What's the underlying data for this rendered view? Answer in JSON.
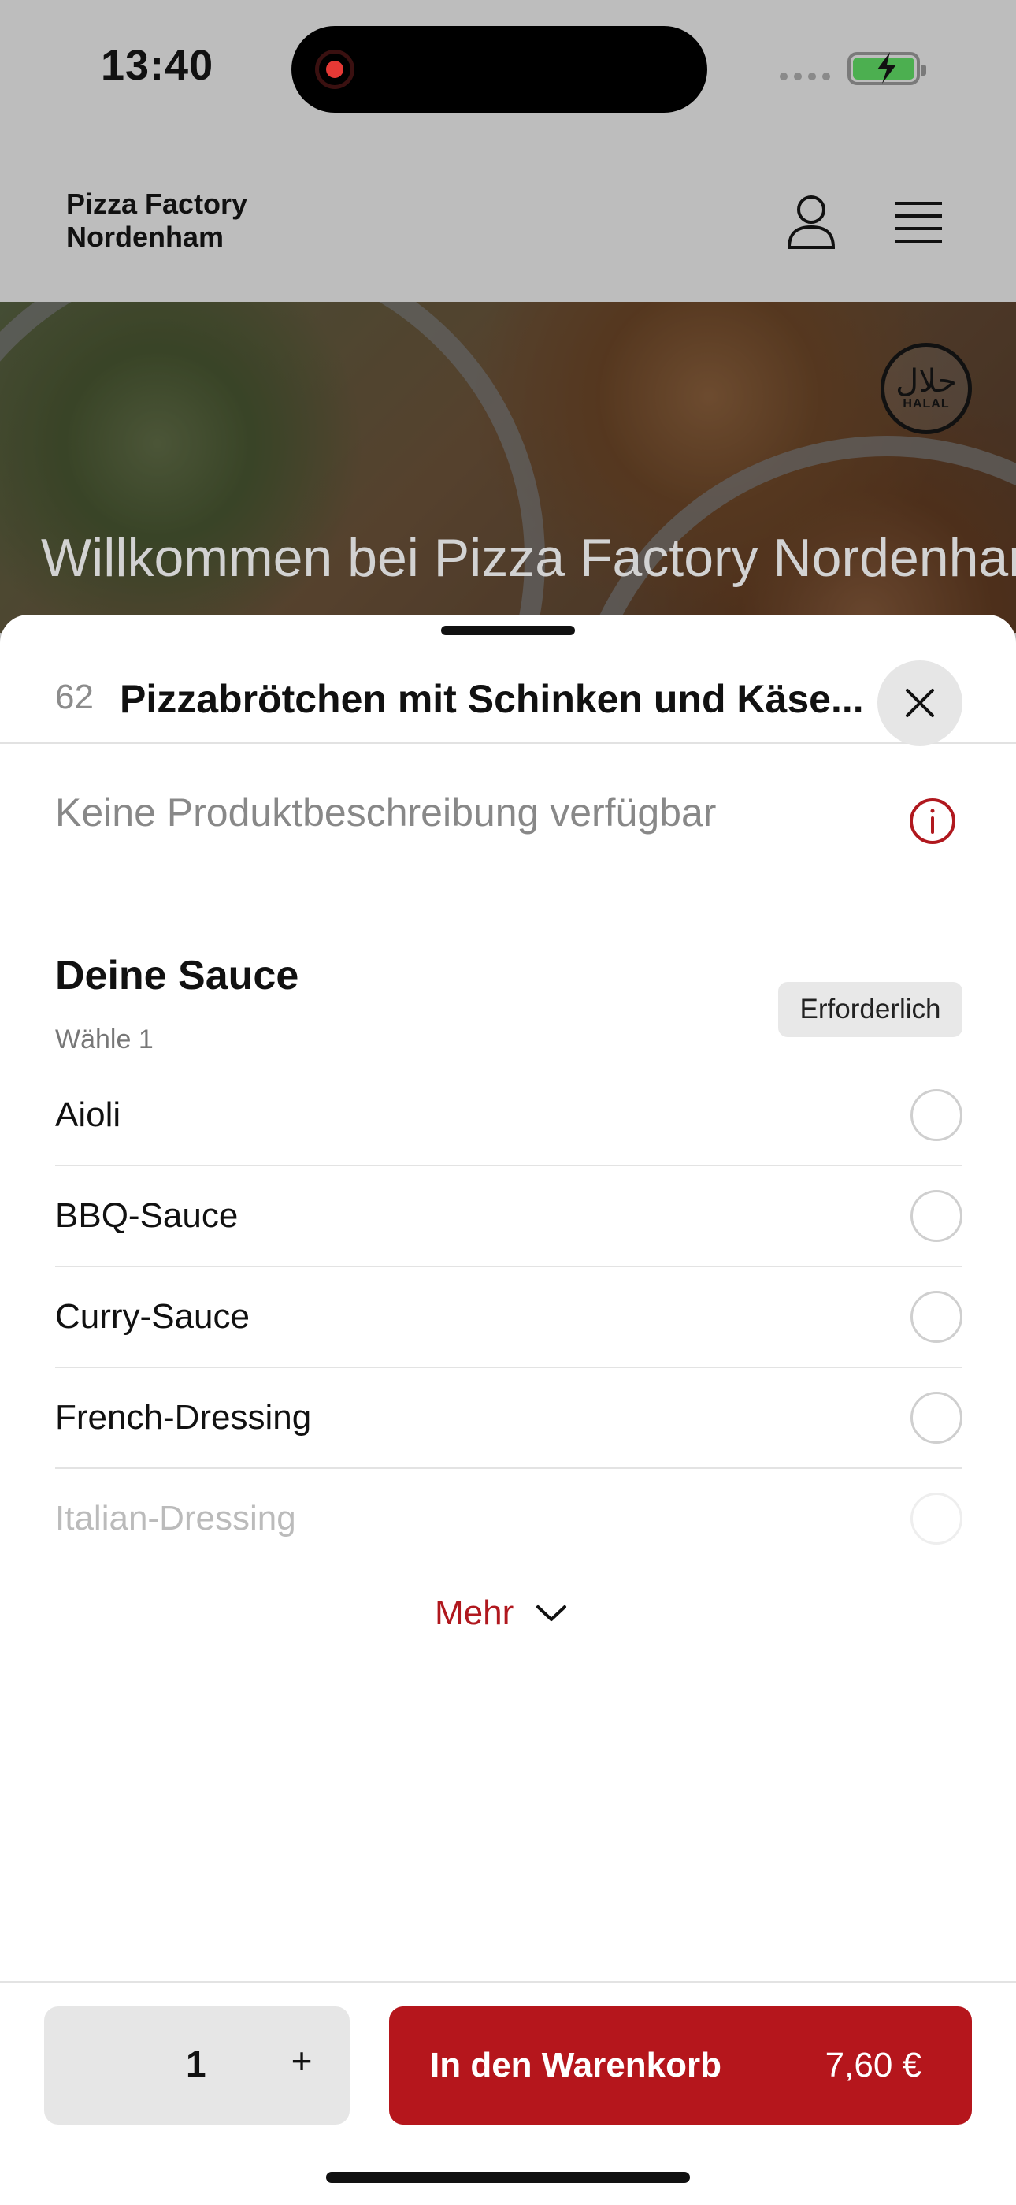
{
  "status_bar": {
    "time": "13:40"
  },
  "header": {
    "brand_line1": "Pizza Factory",
    "brand_line2": "Nordenham"
  },
  "hero": {
    "title": "Willkommen bei Pizza Factory Nordenham",
    "halal_arabic": "حلال",
    "halal_text": "HALAL"
  },
  "product": {
    "number": "62",
    "title": "Pizzabrötchen mit Schinken und Käse...",
    "description": "Keine Produktbeschreibung verfügbar"
  },
  "option_group": {
    "title": "Deine Sauce",
    "subtitle": "Wähle 1",
    "required_label": "Erforderlich",
    "options": [
      {
        "label": "Aioli",
        "selected": false
      },
      {
        "label": "BBQ-Sauce",
        "selected": false
      },
      {
        "label": "Curry-Sauce",
        "selected": false
      },
      {
        "label": "French-Dressing",
        "selected": false
      },
      {
        "label": "Italian-Dressing",
        "selected": false
      }
    ],
    "more_label": "Mehr"
  },
  "bottom": {
    "quantity": "1",
    "plus": "+",
    "cart_label": "In den Warenkorb",
    "price": "7,60 €"
  },
  "colors": {
    "accent": "#b5161c",
    "header_bg": "#bdbdbd"
  }
}
